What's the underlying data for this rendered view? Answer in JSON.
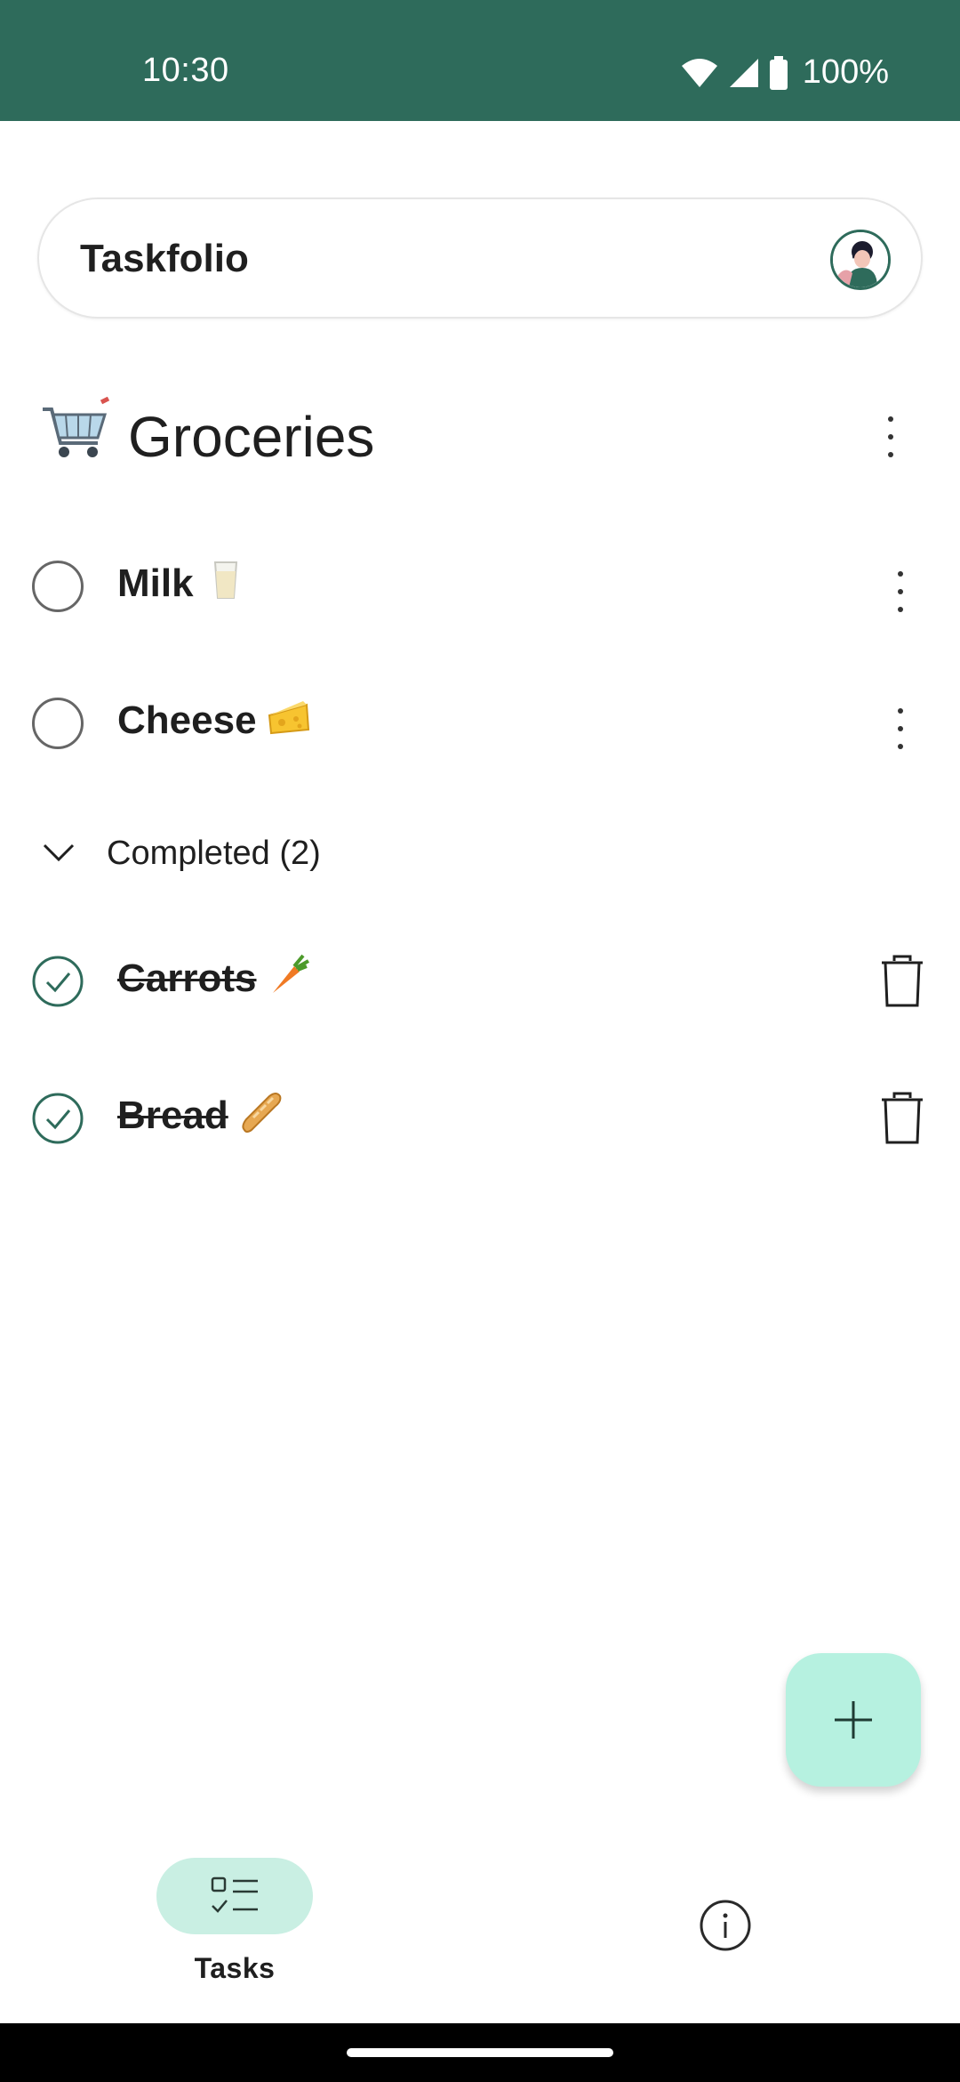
{
  "status_bar": {
    "time": "10:30",
    "battery": "100%",
    "background_color": "#2e6b5b"
  },
  "search_bar": {
    "app_title": "Taskfolio",
    "avatar_icon": "user-avatar-icon"
  },
  "list": {
    "icon": "shopping-cart-icon",
    "title": "Groceries"
  },
  "tasks": [
    {
      "label": "Milk",
      "emoji": "milk-glass-icon",
      "completed": false
    },
    {
      "label": "Cheese",
      "emoji": "cheese-icon",
      "completed": false
    }
  ],
  "completed_section": {
    "label": "Completed (2)",
    "expanded": true
  },
  "completed_tasks": [
    {
      "label": "Carrots",
      "emoji": "carrot-icon",
      "completed": true
    },
    {
      "label": "Bread",
      "emoji": "baguette-icon",
      "completed": true
    }
  ],
  "fab": {
    "icon": "plus-icon",
    "color": "#b6f1e0"
  },
  "bottom_nav": {
    "tasks_label": "Tasks",
    "tasks_icon": "checklist-icon",
    "info_icon": "info-icon",
    "active_color": "#c9efe3"
  },
  "colors": {
    "accent": "#2e6b5b",
    "check_done": "#2e6b5b"
  }
}
